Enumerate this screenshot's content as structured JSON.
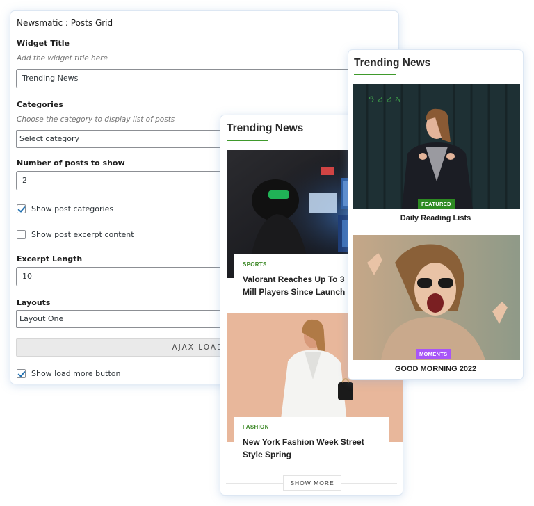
{
  "settings": {
    "title": "Newsmatic : Posts Grid",
    "widget_title_label": "Widget Title",
    "widget_title_hint": "Add the widget title here",
    "widget_title_value": "Trending News",
    "categories_label": "Categories",
    "categories_hint": "Choose the category to display list of posts",
    "categories_value": "Select category",
    "posts_count_label": "Number of posts to show",
    "posts_count_value": "2",
    "show_categories_label": "Show post categories",
    "show_categories_checked": true,
    "show_excerpt_label": "Show post excerpt content",
    "show_excerpt_checked": false,
    "excerpt_length_label": "Excerpt Length",
    "excerpt_length_value": "10",
    "layouts_label": "Layouts",
    "layouts_value": "Layout One",
    "ajax_button_label": "AJAX LOAD M",
    "show_load_more_label": "Show load more button",
    "show_load_more_checked": true
  },
  "preview_a": {
    "title": "Trending News",
    "posts": [
      {
        "category": "SPORTS",
        "headline": "Valorant Reaches Up To 3 Mill Players Since Launch"
      },
      {
        "category": "FASHION",
        "headline": "New York Fashion Week Street Style Spring"
      }
    ],
    "show_more_label": "SHOW MORE"
  },
  "preview_b": {
    "title": "Trending News",
    "posts": [
      {
        "badge": "FEATURED",
        "badge_color": "#2e8b22",
        "caption": "Daily Reading Lists"
      },
      {
        "badge": "MOMENTS",
        "badge_color": "#a855f7",
        "caption": "GOOD MORNING 2022"
      }
    ]
  },
  "colors": {
    "accent_green": "#3f9a2c",
    "check_blue": "#2271b1"
  }
}
